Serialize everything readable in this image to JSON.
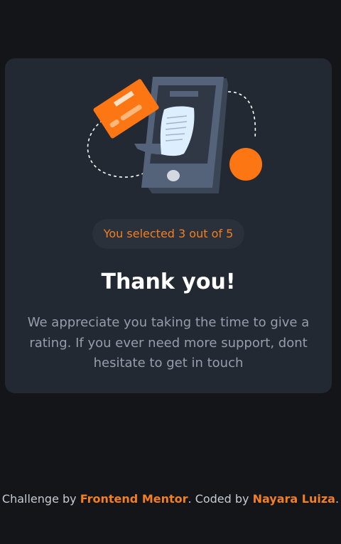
{
  "card": {
    "badge_text": "You selected 3 out of 5",
    "title": "Thank you!",
    "message": "We appreciate you taking the time to give a rating. If you ever need more support, dont hesitate to get in touch"
  },
  "footer": {
    "prefix": "Challenge by ",
    "challenge_link": "Frontend Mentor",
    "middle": ". Coded by ",
    "author_link": "Nayara Luiza",
    "suffix": "."
  },
  "illustration": {
    "icon": "phone-payment-illustration",
    "colors": {
      "orange": "#fc7613",
      "phone_body": "#55637a",
      "phone_screen": "#303846",
      "receipt": "#ddeefe"
    }
  },
  "colors": {
    "background": "#131518",
    "card": "#232932",
    "accent": "#f27f22",
    "text_muted": "#959eac",
    "white": "#ffffff"
  },
  "selected_rating": 3,
  "max_rating": 5
}
